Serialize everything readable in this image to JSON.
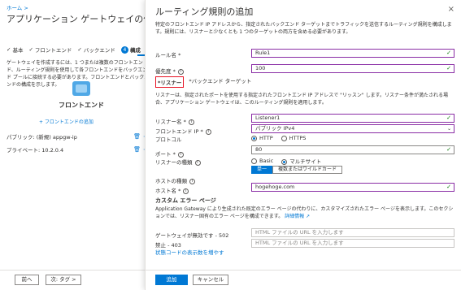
{
  "left": {
    "breadcrumb": "ホーム >",
    "title": "アプリケーション ゲートウェイの作成",
    "steps": [
      {
        "mark": "✓",
        "label": "基本"
      },
      {
        "mark": "✓",
        "label": "フロントエンド"
      },
      {
        "mark": "✓",
        "label": "バックエンド"
      },
      {
        "mark": "4",
        "label": "構成"
      }
    ],
    "description": "ゲートウェイを作成するには、1 つまたは複数のフロントエンド、ルーティング規則を使用して各フロントエンドをバックエンド プールに接続する必要があります。フロントエンドとバックエンドの構成を示します。",
    "frontend_label": "フロントエンド",
    "add_frontend": "+ フロントエンドの追加",
    "ips": [
      {
        "label": "パブリック: (新規) appgw-ip"
      },
      {
        "label": "プライベート: 10.2.0.4"
      }
    ],
    "prev_button": "前へ",
    "next_button": "次: タグ >"
  },
  "panel": {
    "title": "ルーティング規則の追加",
    "close_icon": "×",
    "intro": "特定のフロントエンド IP アドレスから、指定されたバックエンド ターゲットまでトラフィックを送信するルーティング規則を構成します。規則には、リスナーと少なくとも 1 つのターゲットの両方を含める必要があります。",
    "rule_name_label": "ルール名 *",
    "rule_name_value": "Rule1",
    "priority_label": "優先度 *",
    "priority_value": "100",
    "tab_listener": "*リスナー",
    "tab_backend": "*バックエンド ターゲット",
    "listener_desc": "リスナーは、指定されたポートを使用する指定されたフロントエンド IP アドレスで \"リッスン\" します。リスナー条件が満たされる場合、アプリケーション ゲートウェイは、このルーティング規則を適用します。",
    "listener_name_label": "リスナー名 *",
    "listener_name_value": "Listener1",
    "frontend_ip_label": "フロントエンド IP *",
    "frontend_ip_value": "パブリック IPv4",
    "protocol_label": "プロトコル",
    "protocol_http": "HTTP",
    "protocol_https": "HTTPS",
    "port_label": "ポート *",
    "port_value": "80",
    "listener_type_label": "リスナーの種類",
    "type_basic": "Basic",
    "type_multi": "マルチサイト",
    "host_single": "単一",
    "host_multi": "複数またはワイルドカード",
    "host_type_label": "ホストの種類",
    "host_name_label": "ホスト名 *",
    "host_name_value": "hogehoge.com",
    "custom_error_header": "カスタム エラー ページ",
    "custom_error_desc": "Application Gateway により生成された既定のエラー ページの代わりに、カスタマイズされたエラー ページを表示します。このセクションでは、リスナー固有のエラー ページを構成できます。",
    "learn_more": "詳細情報",
    "err502_label": "ゲートウェイが無効です - 502",
    "err502_placeholder": "HTML ファイルの URL を入力します",
    "err403_label": "禁止 - 403",
    "err403_placeholder": "HTML ファイルの URL を入力します",
    "show_all_codes": "状態コードの表示数を増やす",
    "add_button": "追加",
    "cancel_button": "キャンセル"
  }
}
